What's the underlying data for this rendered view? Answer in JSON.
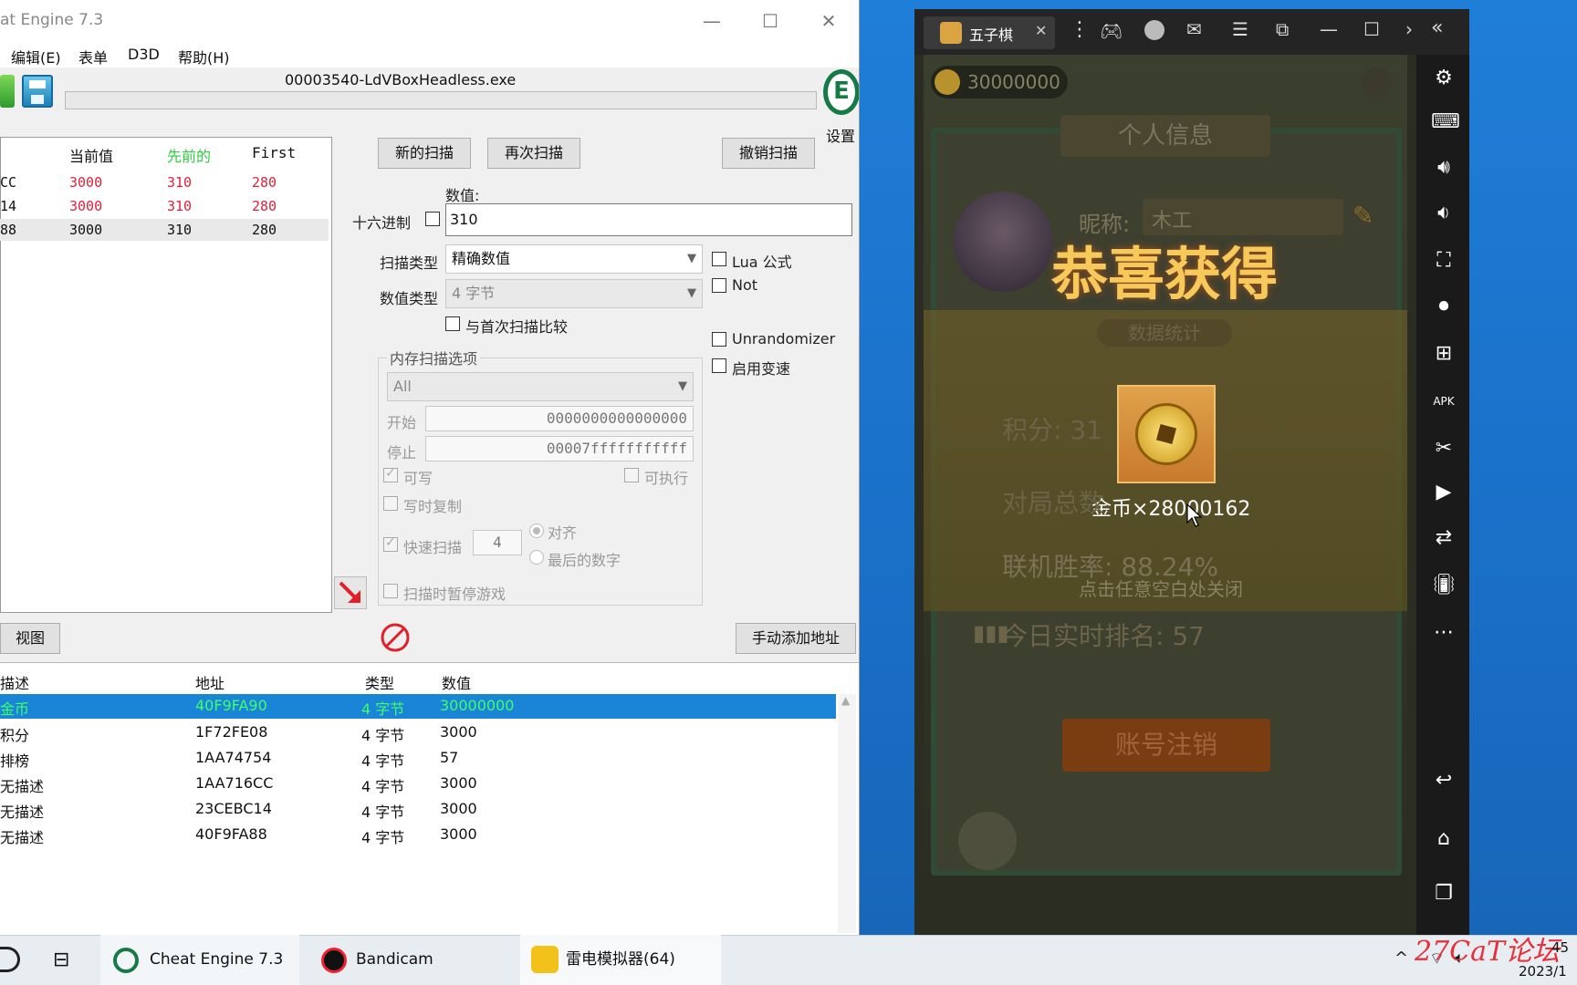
{
  "ce": {
    "title": "at Engine 7.3",
    "menu": [
      "编辑(E)",
      "表单",
      "D3D",
      "帮助(H)"
    ],
    "process": "00003540-LdVBoxHeadless.exe",
    "settings_label": "设置",
    "results": {
      "headers": [
        "当前值",
        "先前的",
        "First"
      ],
      "rows": [
        {
          "addr": "CC",
          "current": "3000",
          "previous": "310",
          "first": "280"
        },
        {
          "addr": "14",
          "current": "3000",
          "previous": "310",
          "first": "280"
        },
        {
          "addr": "88",
          "current": "3000",
          "previous": "310",
          "first": "280"
        }
      ]
    },
    "buttons": {
      "new_scan": "新的扫描",
      "next_scan": "再次扫描",
      "undo_scan": "撤销扫描",
      "view": "视图",
      "add_address": "手动添加地址"
    },
    "value_label": "数值:",
    "hex_label": "十六进制",
    "value_input": "310",
    "scan_type_label": "扫描类型",
    "scan_type_value": "精确数值",
    "value_type_label": "数值类型",
    "value_type_value": "4 字节",
    "compare_first": "与首次扫描比较",
    "lua_label": "Lua 公式",
    "not_label": "Not",
    "unrandomizer_label": "Unrandomizer",
    "speedhack_label": "启用变速",
    "mem_options_label": "内存扫描选项",
    "mem_region": "All",
    "start_label": "开始",
    "start_value": "0000000000000000",
    "stop_label": "停止",
    "stop_value": "00007fffffffffff",
    "writable_label": "可写",
    "executable_label": "可执行",
    "copy_on_write_label": "写时复制",
    "fast_scan_label": "快速扫描",
    "fast_scan_value": "4",
    "align_label": "对齐",
    "last_digits_label": "最后的数字",
    "pause_label": "扫描时暂停游戏",
    "address_table": {
      "headers": [
        "描述",
        "地址",
        "类型",
        "数值"
      ],
      "rows": [
        {
          "desc": "金币",
          "addr": "40F9FA90",
          "type": "4 字节",
          "value": "30000000"
        },
        {
          "desc": "积分",
          "addr": "1F72FE08",
          "type": "4 字节",
          "value": "3000"
        },
        {
          "desc": "排榜",
          "addr": "1AA74754",
          "type": "4 字节",
          "value": "57"
        },
        {
          "desc": "无描述",
          "addr": "1AA716CC",
          "type": "4 字节",
          "value": "3000"
        },
        {
          "desc": "无描述",
          "addr": "23CEBC14",
          "type": "4 字节",
          "value": "3000"
        },
        {
          "desc": "无描述",
          "addr": "40F9FA88",
          "type": "4 字节",
          "value": "3000"
        }
      ]
    }
  },
  "emu": {
    "tab_title": "五子棋",
    "coins": "30000000",
    "panel_title": "个人信息",
    "nickname_label": "昵称:",
    "nickname_value": "木工",
    "reward_title": "恭喜获得",
    "reward_text": "金币×28000162",
    "stats_title": "数据统计",
    "score_label": "积分: 31",
    "games_label": "对局总数",
    "winrate": "联机胜率: 88.24%",
    "close_hint": "点击任意空白处关闭",
    "rank": "今日实时排名: 57",
    "logout": "账号注销"
  },
  "taskbar": {
    "items": [
      "Cheat Engine 7.3",
      "Bandicam",
      "雷电模拟器(64)"
    ],
    "clock_time": "45",
    "clock_date": "2023/1",
    "watermark": "27CaT论坛"
  }
}
